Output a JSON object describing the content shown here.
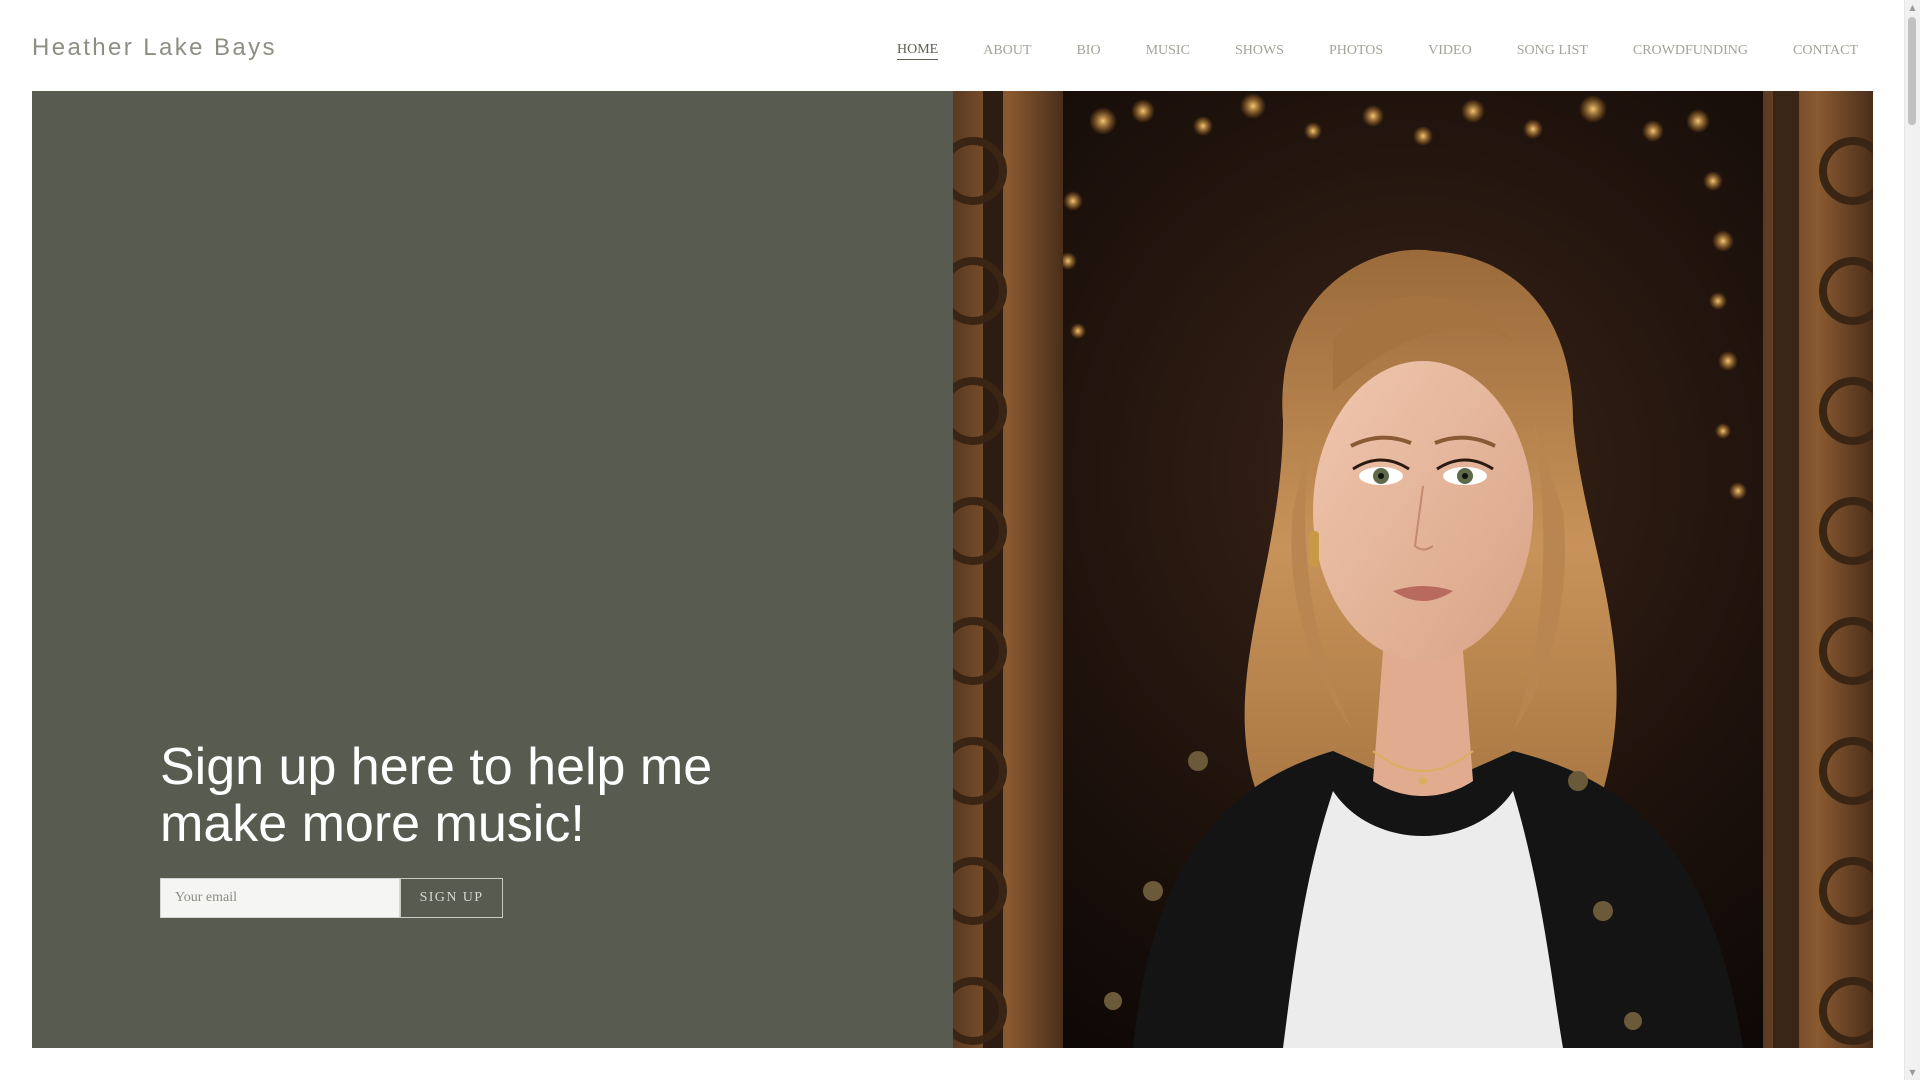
{
  "header": {
    "site_title": "Heather Lake Bays",
    "nav": [
      {
        "label": "HOME",
        "active": true
      },
      {
        "label": "ABOUT",
        "active": false
      },
      {
        "label": "BIO",
        "active": false
      },
      {
        "label": "MUSIC",
        "active": false
      },
      {
        "label": "SHOWS",
        "active": false
      },
      {
        "label": "PHOTOS",
        "active": false
      },
      {
        "label": "VIDEO",
        "active": false
      },
      {
        "label": "SONG LIST",
        "active": false
      },
      {
        "label": "CROWDFUNDING",
        "active": false
      },
      {
        "label": "CONTACT",
        "active": false
      }
    ]
  },
  "hero": {
    "heading": "Sign up here to help me make more music!",
    "email_placeholder": "Your email",
    "signup_label": "SIGN UP",
    "panel_color": "#575b50"
  },
  "scrollbar": {
    "up_icon": "triangle-up-icon",
    "down_icon": "triangle-down-icon"
  }
}
